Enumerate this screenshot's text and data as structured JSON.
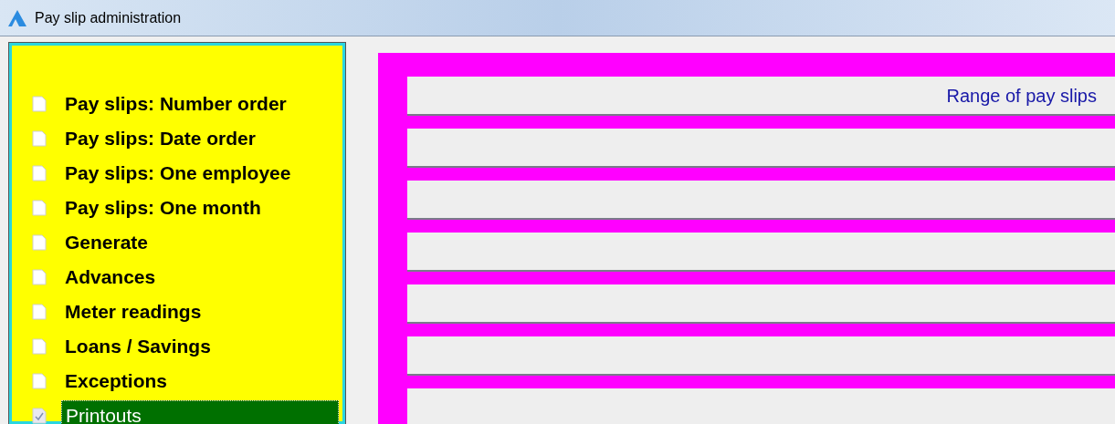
{
  "window": {
    "title": "Pay slip administration"
  },
  "menu": [
    {
      "label": "Pay slips: Number order",
      "selected": false
    },
    {
      "label": "Pay slips: Date order",
      "selected": false
    },
    {
      "label": "Pay slips: One employee",
      "selected": false
    },
    {
      "label": "Pay slips: One month",
      "selected": false
    },
    {
      "label": "Generate",
      "selected": false
    },
    {
      "label": "Advances",
      "selected": false
    },
    {
      "label": "Meter readings",
      "selected": false
    },
    {
      "label": "Loans / Savings",
      "selected": false
    },
    {
      "label": "Exceptions",
      "selected": false
    },
    {
      "label": "Printouts",
      "selected": true
    }
  ],
  "panel": {
    "heading": "Range of pay slips"
  }
}
